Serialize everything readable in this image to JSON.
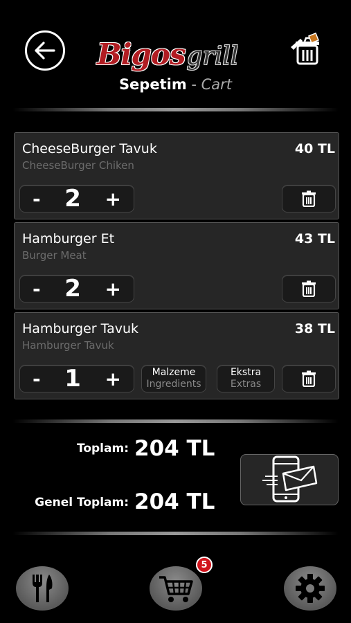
{
  "header": {
    "logo_brand": "Bigos",
    "logo_suffix": "grill",
    "title_tr": "Sepetim",
    "title_sep": " - ",
    "title_en": "Cart"
  },
  "cart": {
    "items": [
      {
        "name": "CheeseBurger Tavuk",
        "subtitle": "CheeseBurger Chiken",
        "price": "40 TL",
        "quantity": "2",
        "minus_label": "-",
        "plus_label": "+"
      },
      {
        "name": "Hamburger Et",
        "subtitle": "Burger Meat",
        "price": "43 TL",
        "quantity": "2",
        "minus_label": "-",
        "plus_label": "+"
      },
      {
        "name": "Hamburger Tavuk",
        "subtitle": "Hamburger Tavuk",
        "price": "38 TL",
        "quantity": "1",
        "minus_label": "-",
        "plus_label": "+",
        "ingredients_tr": "Malzeme",
        "ingredients_en": "Ingredients",
        "extras_tr": "Ekstra",
        "extras_en": "Extras"
      }
    ]
  },
  "totals": {
    "subtotal_label": "Toplam:",
    "subtotal_value": "204 TL",
    "grand_total_label": "Genel Toplam:",
    "grand_total_value": "204 TL"
  },
  "nav": {
    "cart_badge": "5"
  },
  "icons": {
    "back": "arrow-left-icon",
    "clear_cart": "clear-cart-icon",
    "delete": "trash-icon",
    "send_order": "phone-envelope-icon",
    "menu": "fork-knife-icon",
    "cart": "shopping-cart-icon",
    "settings": "gear-icon"
  },
  "colors": {
    "background": "#000000",
    "card": "#262626",
    "brand_red": "#b11c22",
    "badge_red": "#d1141c",
    "muted_text": "#6c6c6c"
  }
}
